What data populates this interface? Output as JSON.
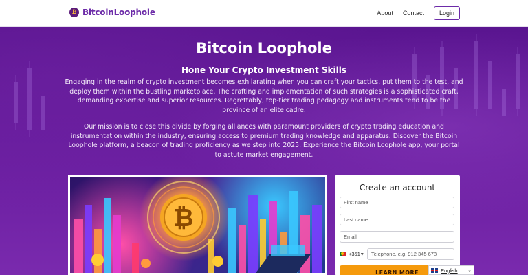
{
  "header": {
    "brand": "BitcoinLoophole",
    "logo_glyph": "₿",
    "nav": {
      "about": "About",
      "contact": "Contact",
      "login": "Login"
    }
  },
  "hero": {
    "title": "Bitcoin Loophole",
    "subtitle": "Hone Your Crypto Investment Skills",
    "paragraph_1": "Engaging in the realm of crypto investment becomes exhilarating when you can craft your tactics, put them to the test, and deploy them within the bustling marketplace. The crafting and implementation of such strategies is a sophisticated craft, demanding expertise and superior resources. Regrettably, top-tier trading pedagogy and instruments tend to be the province of an elite cadre.",
    "paragraph_2": "Our mission is to close this divide by forging alliances with paramount providers of crypto trading education and instrumentation within the industry, ensuring access to premium trading knowledge and apparatus. Discover the Bitcoin Loophole platform, a beacon of trading proficiency as we step into 2025. Experience the Bitcoin Loophole app, your portal to astute market engagement.",
    "illustration_coin_glyph": "₿"
  },
  "form": {
    "title": "Create an account",
    "first_name_placeholder": "First name",
    "last_name_placeholder": "Last name",
    "email_placeholder": "Email",
    "country_code": "+351",
    "country_chevron": "▾",
    "phone_placeholder": "Telephone, e.g.  912 345 678",
    "submit_label": "LEARN MORE"
  },
  "language": {
    "selected": "English",
    "chevron": "⌄"
  },
  "colors": {
    "brand_purple": "#6c2ba8",
    "hero_purple": "#5a1590",
    "cta_orange": "#f59a0c"
  },
  "icons": {
    "logo": "bitcoin-logo-icon",
    "country_flag": "portugal-flag-icon",
    "language_flag": "uk-flag-icon"
  }
}
